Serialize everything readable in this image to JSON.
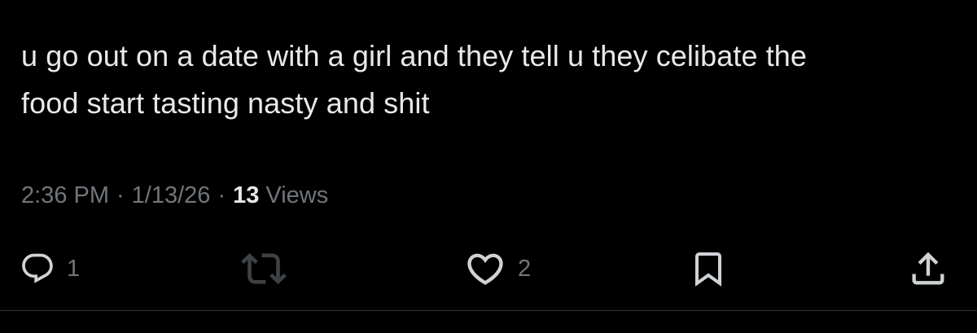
{
  "tweet": {
    "text_lines": [
      "u go out on a date with a girl and they tell u they celibate the",
      "food start tasting nasty and shit"
    ],
    "time": "2:36 PM",
    "date": "1/13/26",
    "separator": "·",
    "views_count": "13",
    "views_label": "Views"
  },
  "actions": {
    "reply": {
      "icon": "reply-icon",
      "count": "1"
    },
    "retweet": {
      "icon": "retweet-icon",
      "count": ""
    },
    "like": {
      "icon": "heart-icon",
      "count": "2"
    },
    "bookmark": {
      "icon": "bookmark-icon"
    },
    "share": {
      "icon": "share-icon"
    }
  },
  "colors": {
    "background": "#000000",
    "text": "#e7e9ea",
    "muted": "#71767b",
    "divider": "#2f3336"
  }
}
